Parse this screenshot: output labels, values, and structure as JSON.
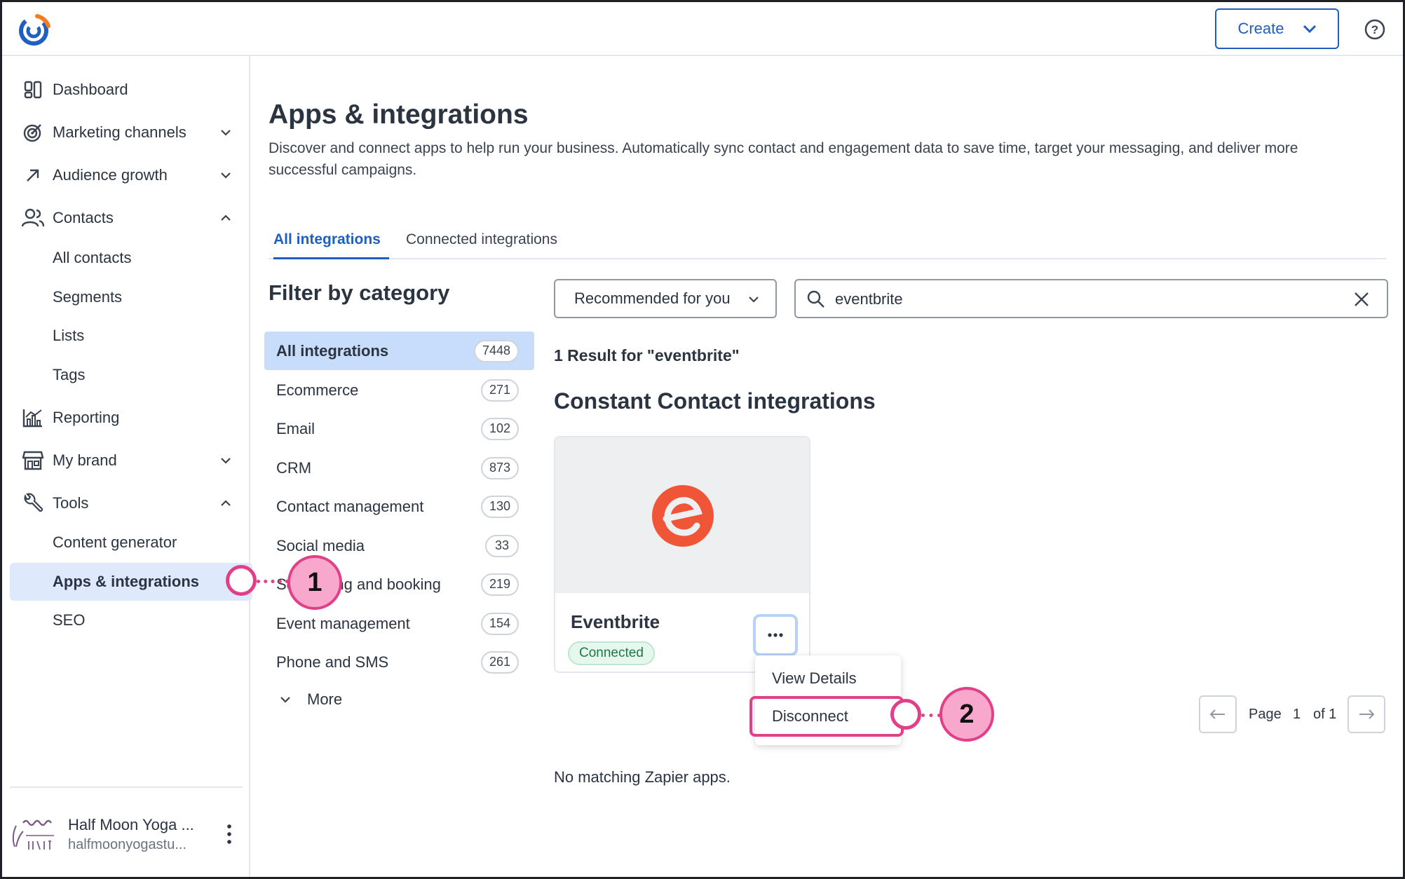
{
  "header": {
    "create_label": "Create"
  },
  "sidebar": {
    "items": [
      {
        "label": "Dashboard",
        "icon": "dashboard-icon"
      },
      {
        "label": "Marketing channels",
        "icon": "target-icon",
        "expandable": true
      },
      {
        "label": "Audience growth",
        "icon": "arrow-up-right-icon",
        "expandable": true
      },
      {
        "label": "Contacts",
        "icon": "people-icon",
        "expanded": true
      },
      {
        "label": "Reporting",
        "icon": "chart-icon"
      },
      {
        "label": "My brand",
        "icon": "storefront-icon",
        "expandable": true
      },
      {
        "label": "Tools",
        "icon": "wrench-icon",
        "expanded": true
      }
    ],
    "contacts_sub": [
      "All contacts",
      "Segments",
      "Lists",
      "Tags"
    ],
    "tools_sub": [
      "Content generator",
      "Apps & integrations",
      "SEO"
    ],
    "active_item": "Apps & integrations",
    "account": {
      "name": "Half Moon Yoga ...",
      "email": "halfmoonyogastu..."
    }
  },
  "main": {
    "title": "Apps & integrations",
    "description": "Discover and connect apps to help run your business. Automatically sync contact and engagement data to save time, target your messaging, and deliver more successful campaigns.",
    "tabs": [
      "All integrations",
      "Connected integrations"
    ],
    "filter_title": "Filter by category",
    "categories": [
      {
        "label": "All integrations",
        "count": "7448"
      },
      {
        "label": "Ecommerce",
        "count": "271"
      },
      {
        "label": "Email",
        "count": "102"
      },
      {
        "label": "CRM",
        "count": "873"
      },
      {
        "label": "Contact management",
        "count": "130"
      },
      {
        "label": "Social media",
        "count": "33"
      },
      {
        "label": "Scheduling and booking",
        "count": "219"
      },
      {
        "label": "Event management",
        "count": "154"
      },
      {
        "label": "Phone and SMS",
        "count": "261"
      }
    ],
    "more_label": "More",
    "sort_select": "Recommended for you",
    "search_value": "eventbrite",
    "result_count": "1 Result for \"eventbrite\"",
    "section_title": "Constant Contact integrations",
    "card": {
      "name": "Eventbrite",
      "status": "Connected",
      "brand_color": "#f05537"
    },
    "menu": {
      "view_details": "View Details",
      "disconnect": "Disconnect"
    },
    "pagination": {
      "page_label": "Page",
      "page": "1",
      "of_label": "of 1"
    },
    "no_match": "No matching Zapier apps."
  },
  "callouts": [
    "1",
    "2"
  ],
  "colors": {
    "accent": "#1f5fbf",
    "callout": "#e23f88",
    "active_bg": "#deeafc"
  }
}
